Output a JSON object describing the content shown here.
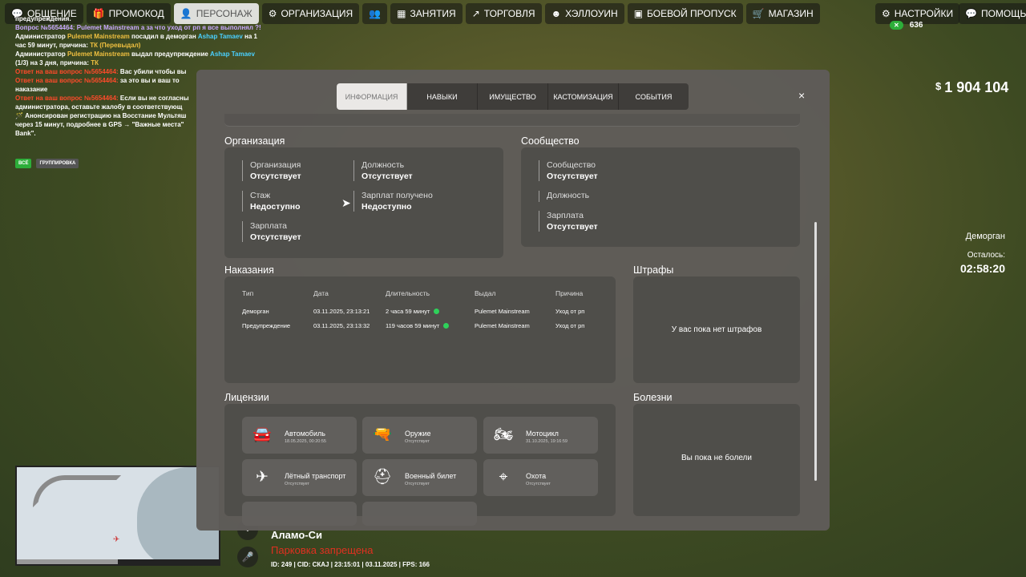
{
  "topbar": {
    "items": [
      {
        "label": "ОБЩЕНИЕ",
        "icon": "chat-icon",
        "glyph": "💬"
      },
      {
        "label": "ПРОМОКОД",
        "icon": "gift-icon",
        "glyph": "🎁"
      },
      {
        "label": "ПЕРСОНАЖ",
        "icon": "user-icon",
        "glyph": "👤",
        "active": true
      },
      {
        "label": "ОРГАНИЗАЦИЯ",
        "icon": "org-icon",
        "glyph": "⚙"
      },
      {
        "label": "",
        "icon": "group-icon",
        "glyph": "👥"
      },
      {
        "label": "ЗАНЯТИЯ",
        "icon": "calendar-icon",
        "glyph": "▦"
      },
      {
        "label": "ТОРГОВЛЯ",
        "icon": "chart-icon",
        "glyph": "↗"
      },
      {
        "label": "ХЭЛЛОУИН",
        "icon": "pumpkin-icon",
        "glyph": "☻"
      },
      {
        "label": "БОЕВОЙ ПРОПУСК",
        "icon": "pass-icon",
        "glyph": "▣"
      },
      {
        "label": "МАГАЗИН",
        "icon": "cart-icon",
        "glyph": "🛒"
      }
    ],
    "settings": {
      "label": "НАСТРОЙКИ",
      "glyph": "⚙"
    },
    "help": {
      "label": "ПОМОЩЬ",
      "glyph": "💬"
    }
  },
  "chat": {
    "lines": [
      [
        {
          "t": "предупреждения.",
          "c": ""
        }
      ],
      [
        {
          "t": "Вопрос №5654464: Pulemet Mainstream а за что уход от рп я все выполнял ?!",
          "c": "c-pu"
        }
      ],
      [
        {
          "t": "Администратор ",
          "c": ""
        },
        {
          "t": "Pulemet Mainstream",
          "c": "c-y"
        },
        {
          "t": " посадил в деморган ",
          "c": ""
        },
        {
          "t": "Ashap Tamaev",
          "c": "c-b"
        },
        {
          "t": " на 1",
          "c": ""
        }
      ],
      [
        {
          "t": "час 59 минут, причина: ",
          "c": ""
        },
        {
          "t": "ТК (Перевыдал)",
          "c": "c-y"
        }
      ],
      [
        {
          "t": "Администратор ",
          "c": ""
        },
        {
          "t": "Pulemet Mainstream",
          "c": "c-y"
        },
        {
          "t": " выдал предупреждение ",
          "c": ""
        },
        {
          "t": "Ashap Tamaev",
          "c": "c-b"
        }
      ],
      [
        {
          "t": "(1/3) на 3 дня, причина: ",
          "c": ""
        },
        {
          "t": "ТК",
          "c": "c-y"
        }
      ],
      [
        {
          "t": "Ответ на ваш вопрос №5654464: ",
          "c": "c-r"
        },
        {
          "t": "Вас убили чтобы вы",
          "c": ""
        }
      ],
      [
        {
          "t": "Ответ на ваш вопрос №5654464: ",
          "c": "c-r"
        },
        {
          "t": "за это вы и ваш то",
          "c": ""
        }
      ],
      [
        {
          "t": "наказание",
          "c": ""
        }
      ],
      [
        {
          "t": "Ответ на ваш вопрос №5654464: ",
          "c": "c-r"
        },
        {
          "t": "Если вы не согласны",
          "c": ""
        }
      ],
      [
        {
          "t": "администратора, оставьте жалобу в соответствующ",
          "c": ""
        }
      ],
      [
        {
          "t": "🪄 Анонсирован регистрацию на Восстание Мультяш",
          "c": ""
        }
      ],
      [
        {
          "t": "через 15 минут, подробнее в GPS → \"Важные места\"",
          "c": ""
        }
      ],
      [
        {
          "t": "Bank\".",
          "c": ""
        }
      ]
    ],
    "filter_all": "ВСЁ",
    "filter_group": "ГРУППИРОВКА"
  },
  "hud": {
    "money": "1 904 104",
    "currency": "$",
    "online": "636",
    "region": "Деморган",
    "remaining_label": "Осталось:",
    "remaining": "02:58:20",
    "area": "Аламо-Си",
    "parking": "Парковка запрещена",
    "info": "ID: 249 | CID: СКАJ | 23:15:01 | 03.11.2025 | FPS: 166"
  },
  "modal": {
    "tabs": [
      "ИНФОРМАЦИЯ",
      "НАВЫКИ",
      "ИМУЩЕСТВО",
      "КАСТОМИЗАЦИЯ",
      "СОБЫТИЯ"
    ],
    "active_tab": 0,
    "close": "×",
    "org": {
      "title": "Организация",
      "fields": [
        {
          "k": "Организация",
          "v": "Отсутствует"
        },
        {
          "k": "Должность",
          "v": "Отсутствует"
        },
        {
          "k": "Стаж",
          "v": "Недоступно"
        },
        {
          "k": "Зарплат получено",
          "v": "Недоступно"
        },
        {
          "k": "Зарплата",
          "v": "Отсутствует"
        }
      ]
    },
    "community": {
      "title": "Сообщество",
      "fields": [
        {
          "k": "Сообщество",
          "v": "Отсутствует"
        },
        {
          "k": "Должность",
          "v": ""
        },
        {
          "k": "Зарплата",
          "v": "Отсутствует"
        }
      ]
    },
    "punishments": {
      "title": "Наказания",
      "headers": [
        "Тип",
        "Дата",
        "Длительность",
        "Выдал",
        "Причина"
      ],
      "rows": [
        [
          "Деморган",
          "03.11.2025, 23:13:21",
          "2 часа 59 минут",
          "Pulemet Mainstream",
          "Уход от рп"
        ],
        [
          "Предупреждение",
          "03.11.2025, 23:13:32",
          "119 часов 59 минут",
          "Pulemet Mainstream",
          "Уход от рп"
        ]
      ]
    },
    "fines": {
      "title": "Штрафы",
      "empty": "У вас пока нет штрафов"
    },
    "licenses": {
      "title": "Лицензии",
      "items": [
        {
          "name": "Автомобиль",
          "sub": "18.05.2025, 00:20:55",
          "icon": "car-icon",
          "glyph": "🚘"
        },
        {
          "name": "Оружие",
          "sub": "Отсутствует",
          "icon": "gun-icon",
          "glyph": "🔫"
        },
        {
          "name": "Мотоцикл",
          "sub": "31.10.2025, 19:16:59",
          "icon": "motorcycle-icon",
          "glyph": "🏍"
        },
        {
          "name": "Лётный транспорт",
          "sub": "Отсутствует",
          "icon": "plane-icon",
          "glyph": "✈"
        },
        {
          "name": "Военный билет",
          "sub": "Отсутствует",
          "icon": "helmet-icon",
          "glyph": "⛑"
        },
        {
          "name": "Охота",
          "sub": "Отсутствует",
          "icon": "crosshair-icon",
          "glyph": "⌖"
        }
      ]
    },
    "diseases": {
      "title": "Болезни",
      "empty": "Вы пока не болели"
    }
  }
}
